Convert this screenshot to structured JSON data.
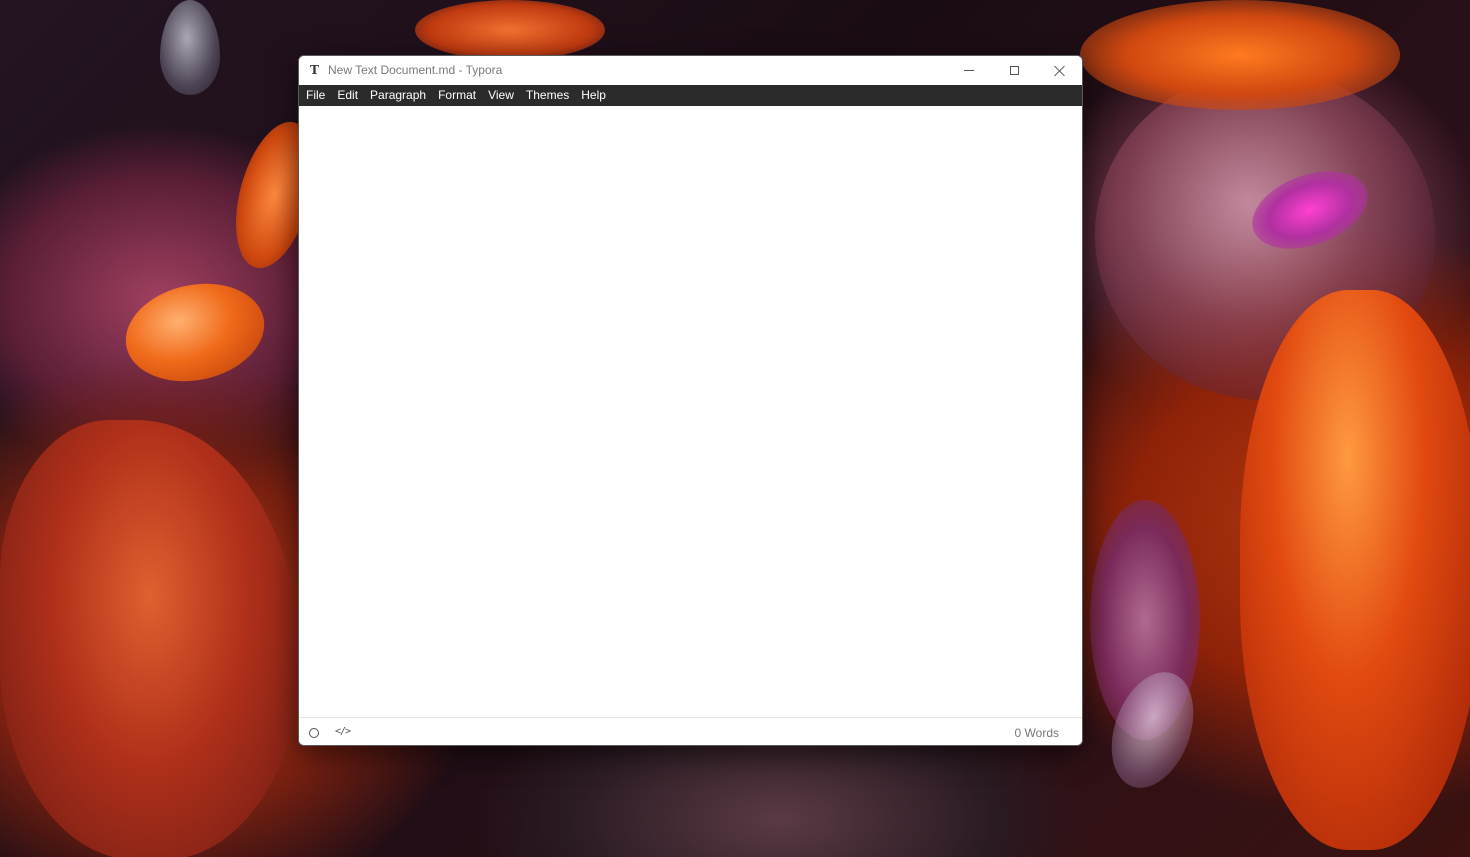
{
  "window": {
    "app_icon": "T",
    "title": "New Text Document.md - Typora"
  },
  "menu": {
    "items": [
      "File",
      "Edit",
      "Paragraph",
      "Format",
      "View",
      "Themes",
      "Help"
    ]
  },
  "statusbar": {
    "source_toggle_glyph": "</>",
    "word_count": "0 Words"
  },
  "icons": {
    "app": "typora-t-icon",
    "minimize": "minimize-icon",
    "maximize": "maximize-icon",
    "close": "close-icon",
    "sidebar": "outline-circle-icon",
    "source_mode": "code-icon"
  }
}
